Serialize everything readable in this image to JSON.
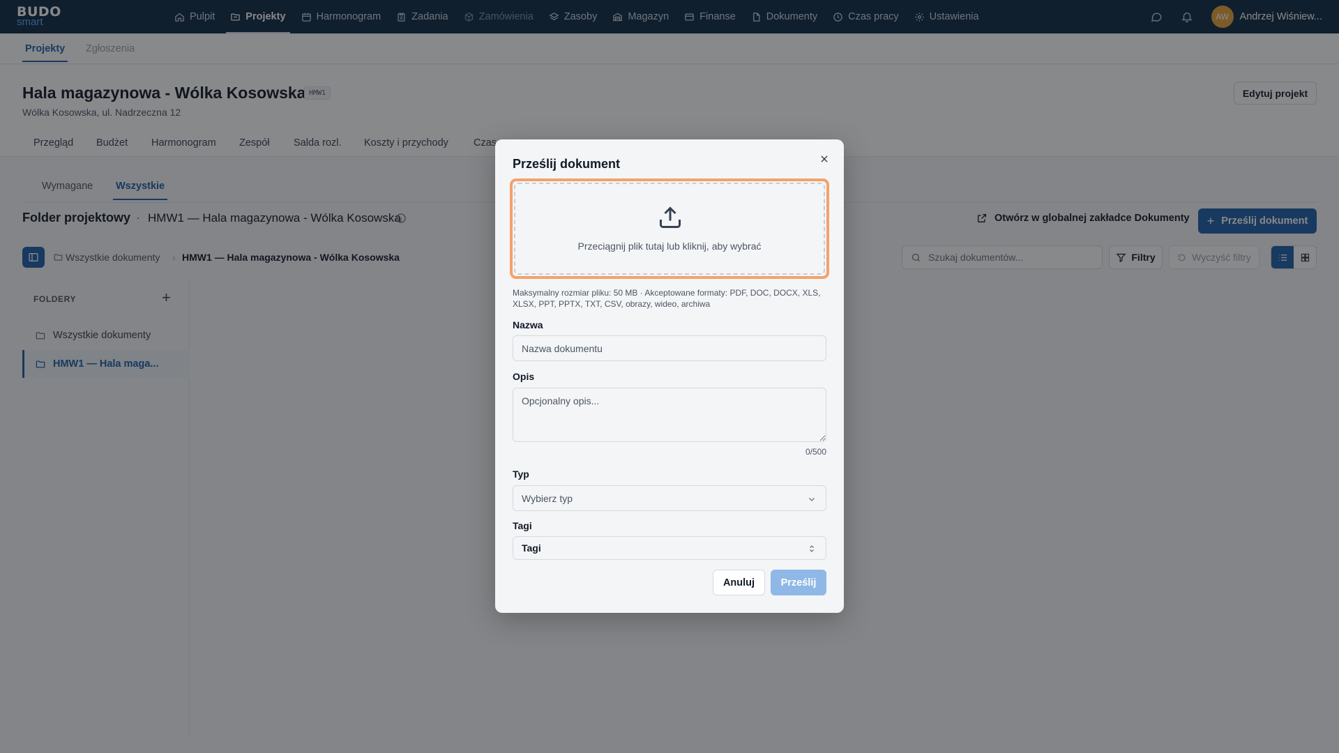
{
  "brand": {
    "line1": "BUDO",
    "line2": "smart"
  },
  "nav": {
    "items": [
      {
        "label": "Pulpit",
        "icon": "home-icon"
      },
      {
        "label": "Projekty",
        "icon": "folder-icon",
        "active": true
      },
      {
        "label": "Harmonogram",
        "icon": "calendar-icon"
      },
      {
        "label": "Zadania",
        "icon": "clipboard-icon"
      },
      {
        "label": "Zamówienia",
        "icon": "package-icon",
        "dim": true
      },
      {
        "label": "Zasoby",
        "icon": "layers-icon"
      },
      {
        "label": "Magazyn",
        "icon": "warehouse-icon"
      },
      {
        "label": "Finanse",
        "icon": "card-icon"
      },
      {
        "label": "Dokumenty",
        "icon": "file-icon"
      },
      {
        "label": "Czas pracy",
        "icon": "clock-icon"
      },
      {
        "label": "Ustawienia",
        "icon": "gear-icon"
      }
    ],
    "user": {
      "initials": "AW",
      "name": "Andrzej Wiśniew..."
    }
  },
  "subtabs": {
    "projects": "Projekty",
    "requests": "Zgłoszenia"
  },
  "project": {
    "title": "Hala magazynowa - Wólka Kosowska",
    "code": "HMW1",
    "address": "Wólka Kosowska, ul. Nadrzeczna 12",
    "edit_label": "Edytuj projekt",
    "tabs": [
      "Przegląd",
      "Budżet",
      "Harmonogram",
      "Zespół",
      "Salda rozl.",
      "Koszty i przychody",
      "Czas"
    ]
  },
  "documents": {
    "tabs": {
      "required": "Wymagane",
      "all": "Wszystkie"
    },
    "folder_title": "Folder projektowy",
    "separator": "·",
    "folder_subtitle": "HMW1 — Hala magazynowa - Wólka Kosowska",
    "global_link": "Otwórz w globalnej zakładce Dokumenty",
    "upload_label": "Prześlij dokument",
    "breadcrumb": [
      "Wszystkie dokumenty",
      "HMW1 — Hala magazynowa - Wólka Kosowska"
    ],
    "search_placeholder": "Szukaj dokumentów...",
    "filters_label": "Filtry",
    "clear_label": "Wyczyść filtry",
    "folders_label": "FOLDERY",
    "folders": [
      "Wszystkie dokumenty",
      "HMW1 — Hala maga..."
    ]
  },
  "modal": {
    "title": "Prześlij dokument",
    "dropzone_text": "Przeciągnij plik tutaj lub kliknij, aby wybrać",
    "hint": "Maksymalny rozmiar pliku: 50 MB · Akceptowane formaty: PDF, DOC, DOCX, XLS, XLSX, PPT, PPTX, TXT, CSV, obrazy, wideo, archiwa",
    "name_label": "Nazwa",
    "name_placeholder": "Nazwa dokumentu",
    "desc_label": "Opis",
    "desc_placeholder": "Opcjonalny opis...",
    "counter": "0/500",
    "type_label": "Typ",
    "type_value": "Wybierz typ",
    "tags_label": "Tagi",
    "tags_value": "Tagi",
    "cancel": "Anuluj",
    "submit": "Prześlij"
  },
  "colors": {
    "nav_bg": "#0f2a44",
    "accent": "#1f5fa9",
    "dropzone_focus": "#f4a26b",
    "submit_disabled": "#8fb8e6",
    "avatar": "#e8a23a"
  }
}
